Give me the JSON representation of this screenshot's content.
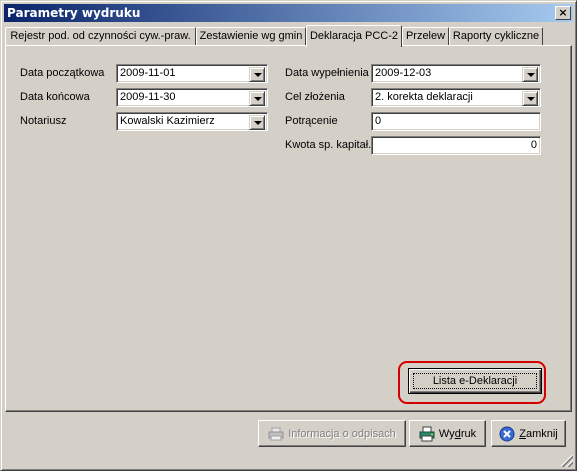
{
  "window": {
    "title": "Parametry wydruku",
    "close_glyph": "×"
  },
  "tabs": [
    {
      "label": "Rejestr pod. od czynności cyw.-praw."
    },
    {
      "label": "Zestawienie wg gmin"
    },
    {
      "label": "Deklaracja PCC-2"
    },
    {
      "label": "Przelew"
    },
    {
      "label": "Raporty cykliczne"
    }
  ],
  "active_tab": "Deklaracja PCC-2",
  "form": {
    "data_poczatkowa": {
      "label": "Data początkowa",
      "value": "2009-11-01"
    },
    "data_koncowa": {
      "label": "Data końcowa",
      "value": "2009-11-30"
    },
    "notariusz": {
      "label": "Notariusz",
      "value": "Kowalski Kazimierz"
    },
    "data_wypelnienia": {
      "label": "Data wypełnienia",
      "value": "2009-12-03"
    },
    "cel_zlozenia": {
      "label": "Cel złożenia",
      "value": "2. korekta deklaracji"
    },
    "potracenie": {
      "label": "Potrącenie",
      "value": "0"
    },
    "kwota": {
      "label": "Kwota sp. kapitał.",
      "value": "0"
    }
  },
  "buttons": {
    "lista": {
      "label": "Lista e-Deklaracji"
    },
    "informacja": {
      "label": "Informacja o odpisach",
      "icon": "printer-disabled-icon"
    },
    "wydruk": {
      "pre": "Wy",
      "key": "d",
      "post": "ruk",
      "icon": "printer-icon"
    },
    "zamknij": {
      "pre": "",
      "key": "Z",
      "post": "amknij",
      "icon": "close-circle-icon"
    }
  }
}
